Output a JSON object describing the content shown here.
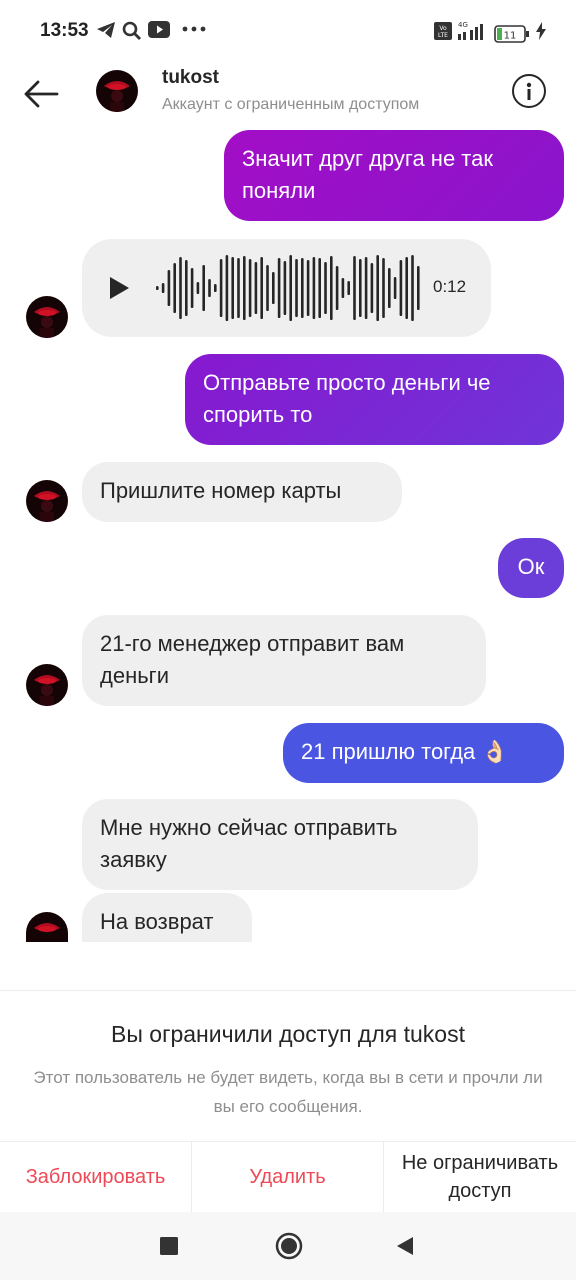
{
  "status_bar": {
    "time": "13:53",
    "icons": [
      "telegram-icon",
      "search-icon",
      "youtube-icon",
      "more-dots-icon"
    ],
    "network_label": "4G",
    "volte_label": "Vo LTE",
    "battery_level": "11"
  },
  "header": {
    "username": "tukost",
    "subtitle": "Аккаунт с ограниченным доступом"
  },
  "messages": {
    "m1": "Значит друг друга не так поняли",
    "voice_duration": "0:12",
    "m2": "Отправьте просто деньги че спорить то",
    "m3": "Пришлите номер карты",
    "m4": "Ок",
    "m5": "21-го менеджер отправит вам деньги",
    "m6": "21 пришлю тогда 👌🏻",
    "m7": "Мне нужно сейчас отправить заявку",
    "m8": "На возврат"
  },
  "restricted_panel": {
    "title": "Вы ограничили доступ для tukost",
    "description": "Этот пользователь не будет видеть, когда вы в сети и прочли ли вы его сообщения.",
    "block_label": "Заблокировать",
    "delete_label": "Удалить",
    "unrestrict_label": "Не ограничивать доступ"
  },
  "colors": {
    "accent_red": "#ed4956",
    "bubble_incoming": "#efefef",
    "gradient_purple": "#9f0ec9",
    "gradient_violet": "#6c3ad6",
    "gradient_blue": "#4a55e2"
  }
}
